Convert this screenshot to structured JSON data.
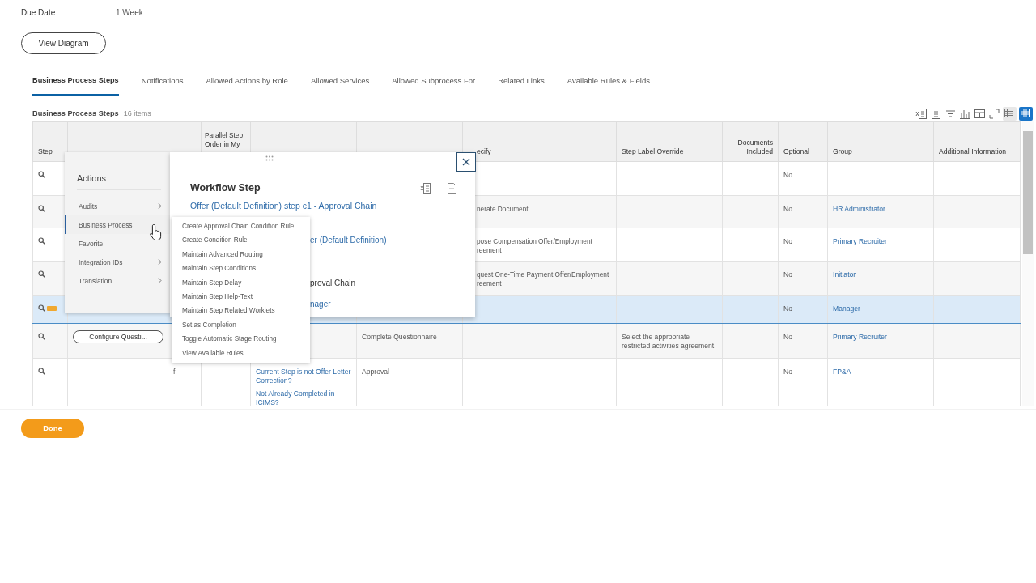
{
  "summary": {
    "label": "Due Date",
    "value": "1 Week"
  },
  "view_button": "View Diagram",
  "tabs": [
    {
      "label": "Business Process Steps",
      "selected": true
    },
    {
      "label": "Notifications",
      "selected": false
    },
    {
      "label": "Allowed Actions by Role",
      "selected": false
    },
    {
      "label": "Allowed Services",
      "selected": false
    },
    {
      "label": "Allowed Subprocess For",
      "selected": false
    },
    {
      "label": "Related Links",
      "selected": false
    },
    {
      "label": "Available Rules & Fields",
      "selected": false
    }
  ],
  "grid": {
    "title": "Business Process Steps",
    "count": "16 items",
    "view_toggles": [
      {
        "selected": false
      },
      {
        "selected": true
      }
    ],
    "columns": [
      {
        "label": "Step"
      },
      {},
      {},
      {
        "label": "Parallel Step Order in My"
      },
      {},
      {},
      {
        "label": "ecify"
      },
      {
        "label": "Step Label Override"
      },
      {
        "label": "Documents Included"
      },
      {
        "label": "Optional"
      },
      {
        "label": "Group"
      },
      {
        "label": "Additional Information"
      }
    ],
    "rows": [
      {
        "selected": false,
        "related_actions": false,
        "cells": {
          "optional": "No"
        }
      },
      {
        "selected": false,
        "related_actions": false,
        "cells": {
          "specify": "nerate Document",
          "optional": "No",
          "group": "HR Administrator"
        }
      },
      {
        "selected": false,
        "related_actions": false,
        "cells": {
          "specify": "pose Compensation Offer/Employment\nreement",
          "optional": "No",
          "group": "Primary Recruiter"
        }
      },
      {
        "selected": false,
        "related_actions": false,
        "cells": {
          "specify": "quest One-Time Payment Offer/Employment\nreement",
          "optional": "No",
          "group": "Initiator"
        }
      },
      {
        "selected": true,
        "related_actions": true,
        "cells": {
          "optional": "No",
          "group": "Manager"
        }
      },
      {
        "selected": false,
        "related_actions": false,
        "button": "Configure Questi...",
        "cells": {
          "column_6": "Complete Questionnaire",
          "step_label_override": "Select the appropriate restricted activities agreement",
          "optional": "No",
          "group": "Primary Recruiter"
        }
      },
      {
        "selected": false,
        "related_actions": false,
        "cells": {
          "column_3": "f",
          "column_5": [
            "Current Step is not Offer Letter Correction?",
            "Not Already Completed in ICIMS?"
          ],
          "column_6": "Approval",
          "optional": "No",
          "group": "FP&A"
        }
      }
    ]
  },
  "actions_menu": {
    "title": "Actions",
    "items": [
      {
        "label": "Audits",
        "submenu": true,
        "selected": false
      },
      {
        "label": "Business Process",
        "submenu": false,
        "selected": true
      },
      {
        "label": "Favorite",
        "submenu": false,
        "selected": false
      },
      {
        "label": "Integration IDs",
        "submenu": true,
        "selected": false
      },
      {
        "label": "Translation",
        "submenu": true,
        "selected": false
      }
    ]
  },
  "submenu": [
    "Create Approval Chain Condition Rule",
    "Create Condition Rule",
    "Maintain Advanced Routing",
    "Maintain Step Conditions",
    "Maintain Step Delay",
    "Maintain Step Help-Text",
    "Maintain Step Related Worklets",
    "Set as Completion",
    "Toggle Automatic Stage Routing",
    "View Available Rules"
  ],
  "popup": {
    "title": "Workflow Step",
    "link": "Offer (Default Definition) step c1 - Approval Chain",
    "fields": [
      {
        "text": "er (Default Definition)",
        "kind": "link"
      },
      {
        "text": "proval Chain",
        "kind": "text"
      },
      {
        "text": "nager",
        "kind": "link"
      }
    ]
  },
  "done_button": "Done"
}
